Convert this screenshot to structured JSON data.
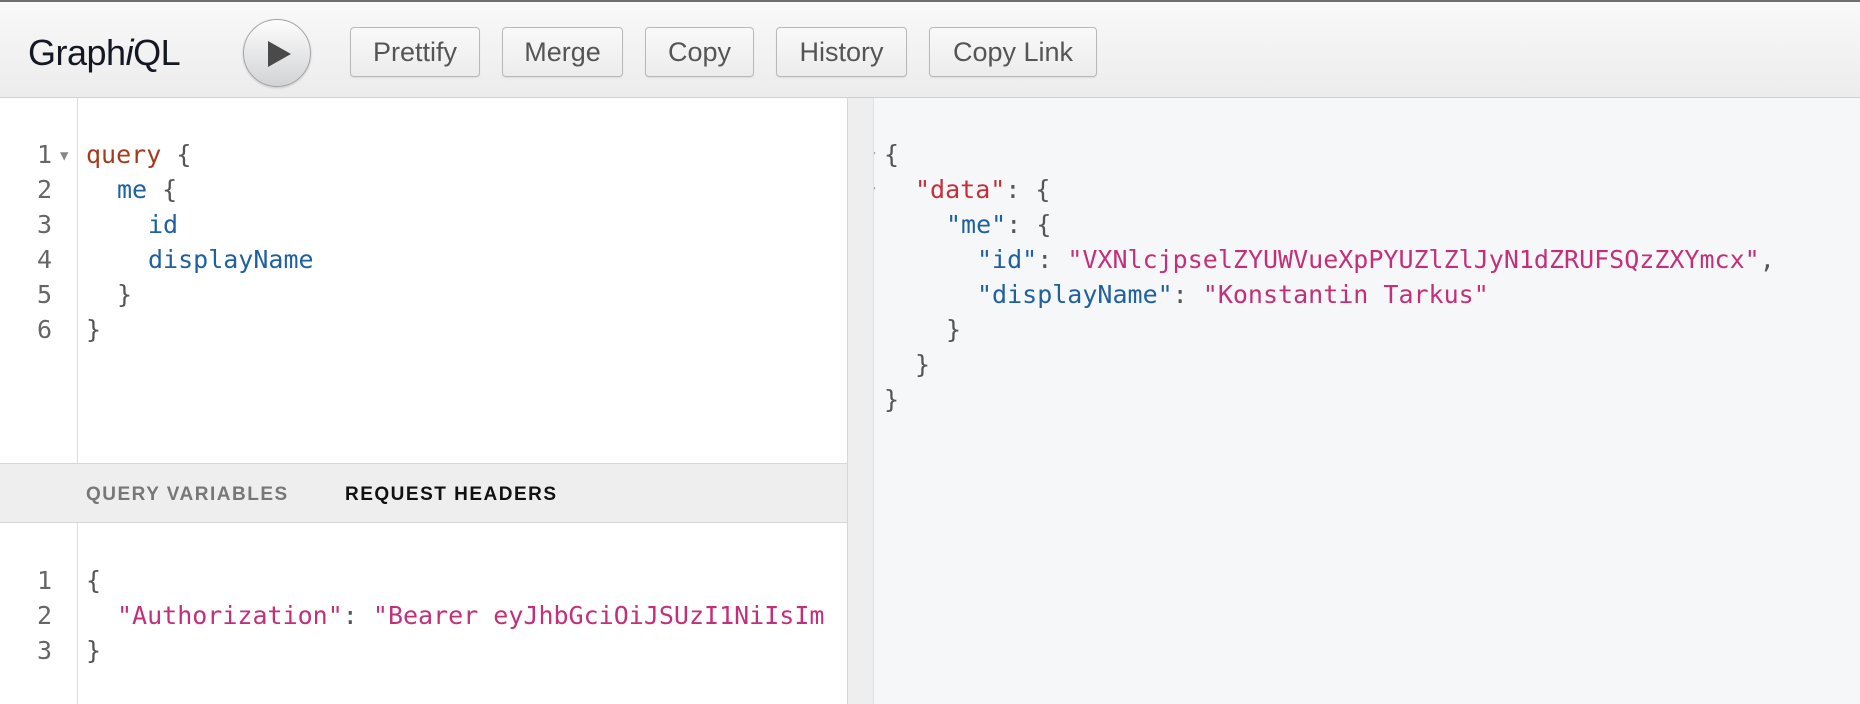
{
  "app": {
    "title_prefix": "Graph",
    "title_italic": "i",
    "title_suffix": "QL"
  },
  "toolbar": {
    "execute_button": "play-icon",
    "buttons": [
      "Prettify",
      "Merge",
      "Copy",
      "History",
      "Copy Link"
    ]
  },
  "query_editor": {
    "line_numbers": [
      "1",
      "2",
      "3",
      "4",
      "5",
      "6"
    ],
    "lines": [
      {
        "keyword": "query",
        "rest": " {"
      },
      {
        "field": "me",
        "rest": " {"
      },
      {
        "field": "id",
        "rest": ""
      },
      {
        "field": "displayName",
        "rest": ""
      },
      {
        "rest": "}"
      },
      {
        "rest": "}"
      }
    ]
  },
  "variables_tabs": {
    "query_variables": "QUERY VARIABLES",
    "request_headers": "REQUEST HEADERS",
    "active": "request_headers"
  },
  "headers_editor": {
    "line_numbers": [
      "1",
      "2",
      "3"
    ],
    "open": "{",
    "key": "\"Authorization\"",
    "colon": ": ",
    "value": "\"Bearer eyJhbGciOiJSUzI1NiIsIm",
    "close": "}"
  },
  "result": {
    "open": "{",
    "data_key": "\"data\"",
    "me_key": "\"me\"",
    "id_key": "\"id\"",
    "id_value": "\"VXNlcjpselZYUWVueXpPYUZlZlJyN1dZRUFSQzZXYmcx\"",
    "display_name_key": "\"displayName\"",
    "display_name_value": "\"Konstantin Tarkus\"",
    "close": "}"
  },
  "colors": {
    "keyword": "#a33c1e",
    "field": "#1f61a0",
    "string": "#c42f79",
    "top_key": "#c42f39"
  }
}
